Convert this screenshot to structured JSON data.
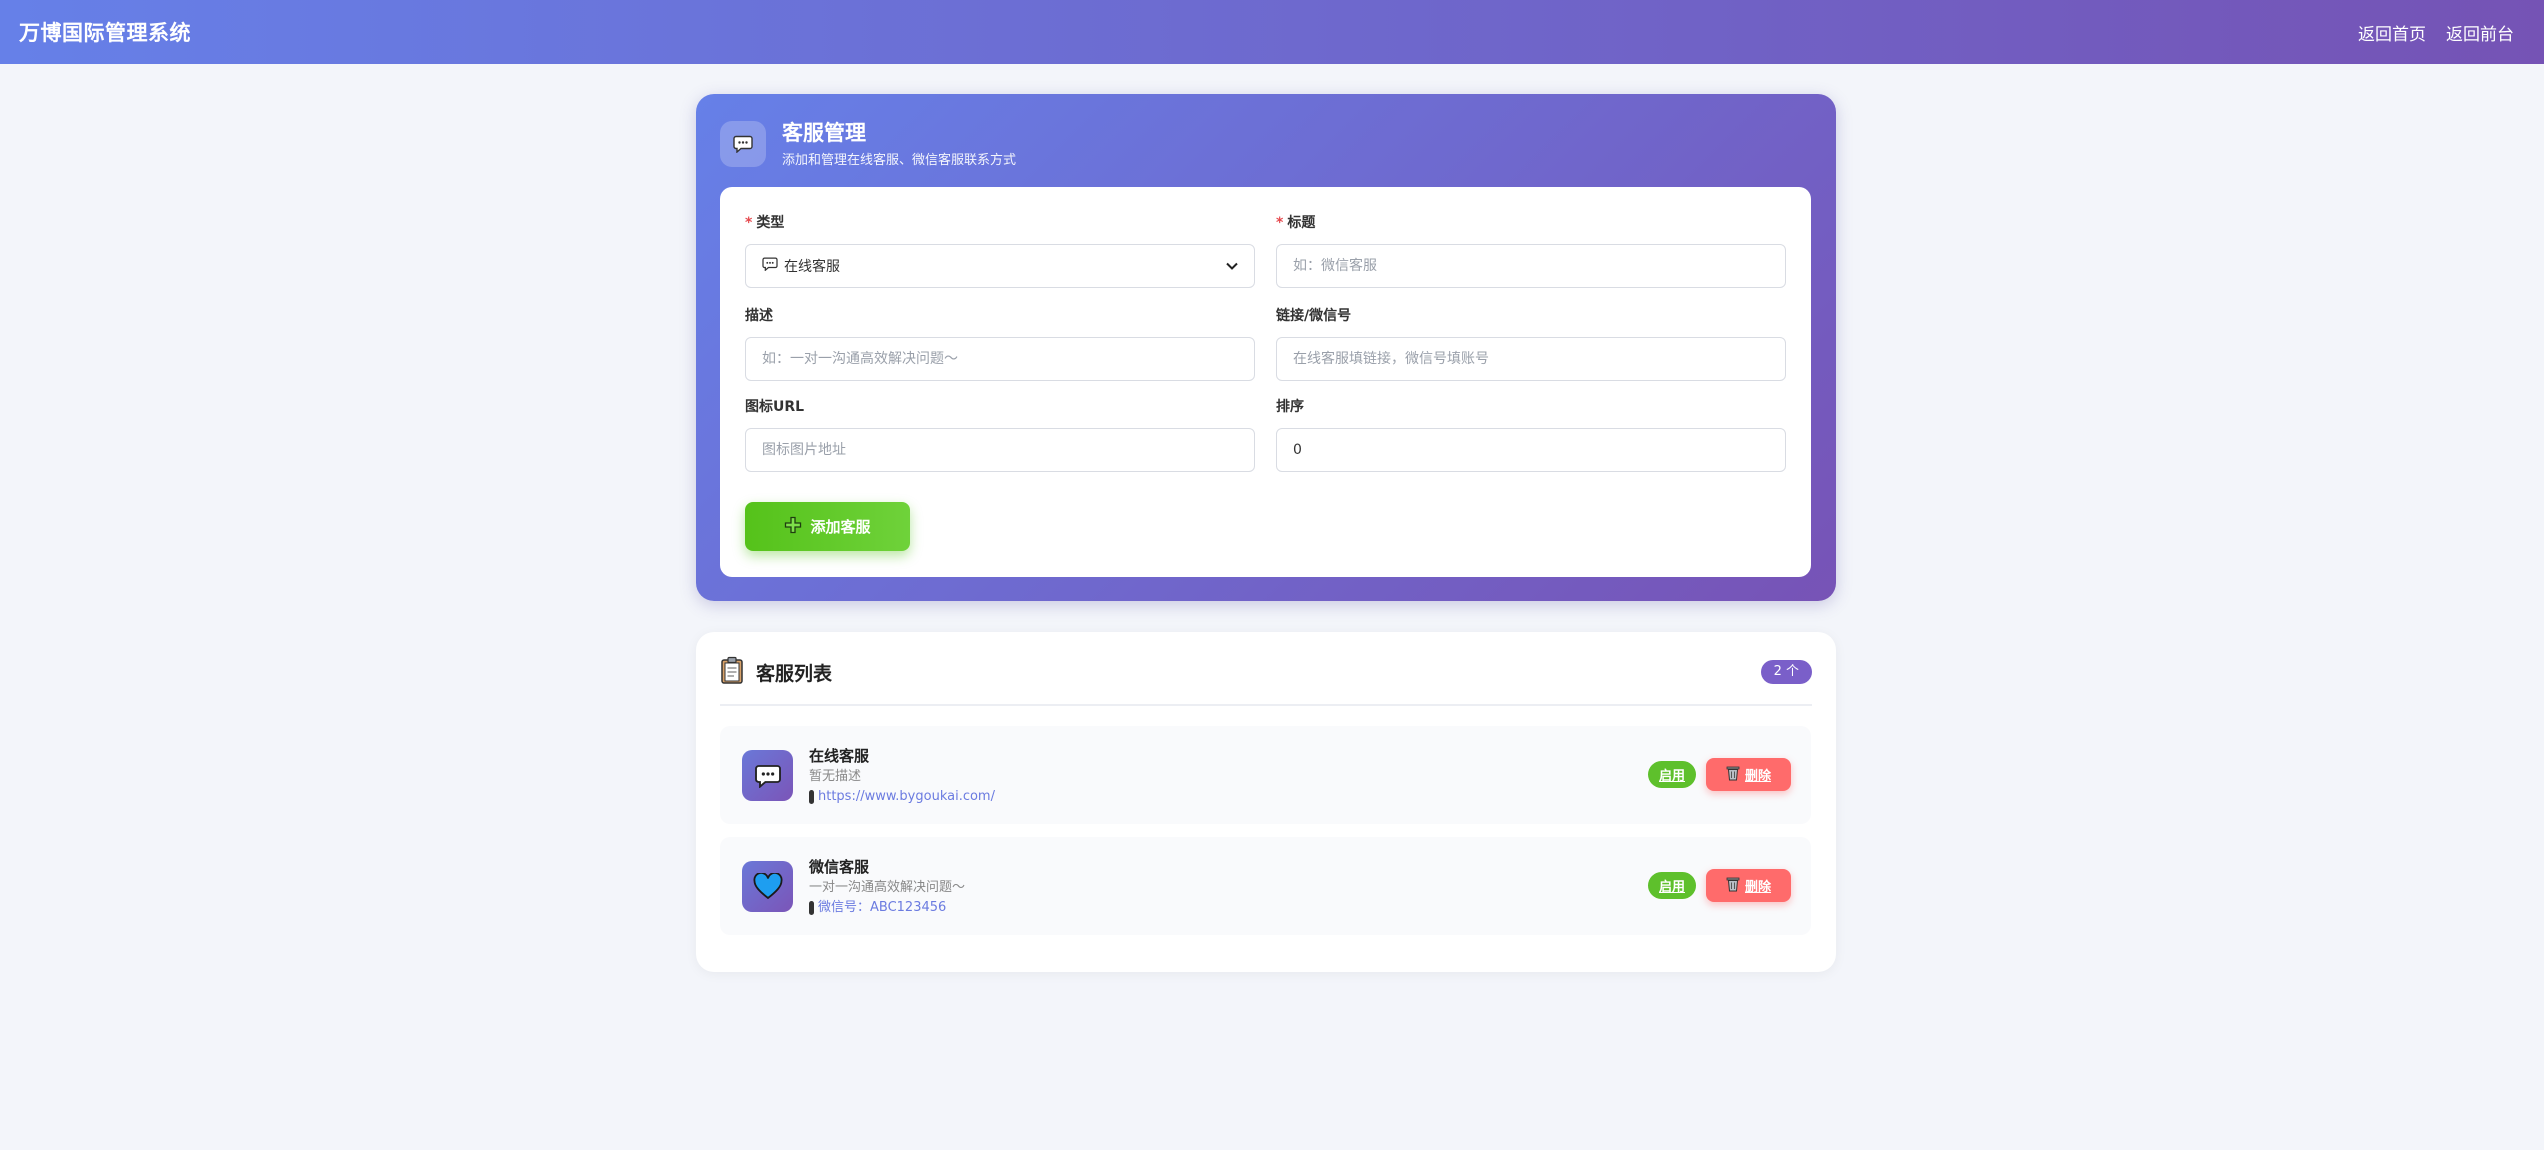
{
  "header": {
    "brand": "万博国际管理系统",
    "links": [
      "返回首页",
      "返回前台"
    ]
  },
  "form": {
    "title": "客服管理",
    "subtitle": "添加和管理在线客服、微信客服联系方式",
    "fields": {
      "type": {
        "label": "类型",
        "required": true,
        "value": "在线客服",
        "icon": "speech-bubble-icon"
      },
      "title": {
        "label": "标题",
        "required": true,
        "value": "",
        "placeholder": "如：微信客服"
      },
      "description": {
        "label": "描述",
        "value": "",
        "placeholder": "如：一对一沟通高效解决问题～"
      },
      "link": {
        "label": "链接/微信号",
        "value": "",
        "placeholder": "在线客服填链接，微信号填账号"
      },
      "icon_url": {
        "label": "图标URL",
        "value": "",
        "placeholder": "图标图片地址"
      },
      "sort": {
        "label": "排序",
        "value": "0"
      }
    },
    "submit_label": "添加客服"
  },
  "list": {
    "title": "客服列表",
    "count": "2 个",
    "items": [
      {
        "title": "在线客服",
        "description": "暂无描述",
        "link": "https://www.bygoukai.com/",
        "icon": "speech-bubble-icon",
        "enable_label": "启用",
        "delete_label": "删除"
      },
      {
        "title": "微信客服",
        "description": "一对一沟通高效解决问题～",
        "link": "微信号：ABC123456",
        "icon": "heart-icon",
        "enable_label": "启用",
        "delete_label": "删除"
      }
    ]
  },
  "colors": {
    "gradient_start": "#6680e8",
    "gradient_end": "#7553b5",
    "success": "#5ec02c",
    "danger": "#ff6b6b",
    "badge": "#7a5fc9"
  }
}
